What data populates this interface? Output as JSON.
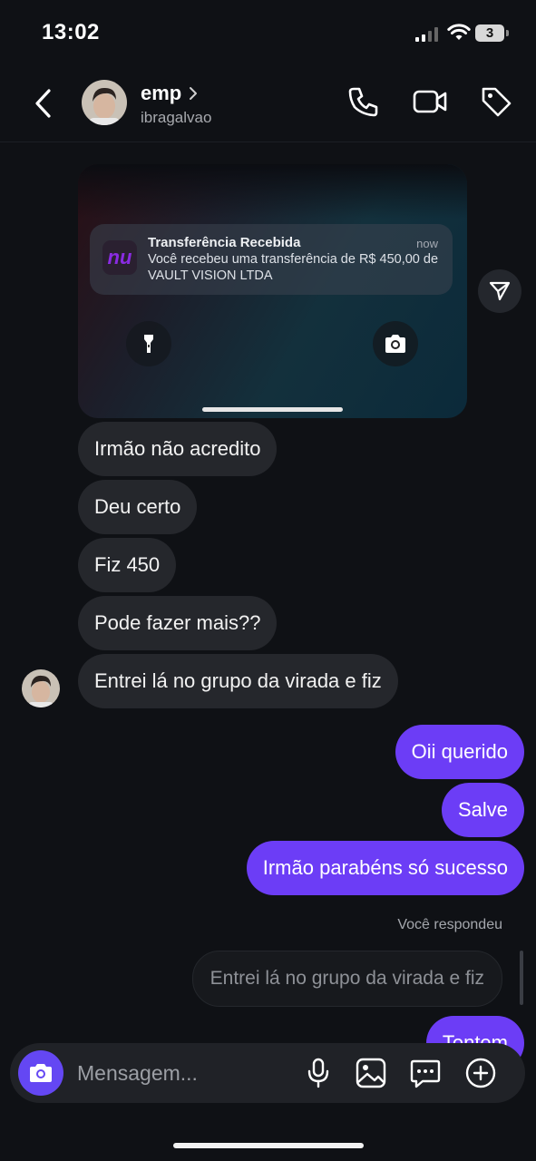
{
  "status": {
    "time": "13:02",
    "battery": "3"
  },
  "header": {
    "name": "emp",
    "username": "ibragalvao"
  },
  "story_reply": {
    "notification": {
      "title": "Transferência Recebida",
      "time": "now",
      "body": "Você recebeu uma transferência de R$ 450,00 de VAULT VISION LTDA",
      "app_logo": "nu"
    }
  },
  "messages": {
    "incoming": [
      "Irmão não acredito",
      "Deu certo",
      "Fiz 450",
      "Pode fazer mais??",
      "Entrei lá no grupo da virada e fiz"
    ],
    "outgoing": [
      "Oii querido",
      "Salve",
      "Irmão parabéns só sucesso"
    ],
    "replied_label": "Você respondeu",
    "quoted": "Entrei lá no grupo da virada e fiz",
    "partial_outgoing": "Tentem"
  },
  "composer": {
    "placeholder": "Mensagem..."
  },
  "colors": {
    "background": "#0f1115",
    "outgoing_bubble": "#6c3df6",
    "incoming_bubble": "#25272c",
    "camera_button": "#6447f3"
  }
}
